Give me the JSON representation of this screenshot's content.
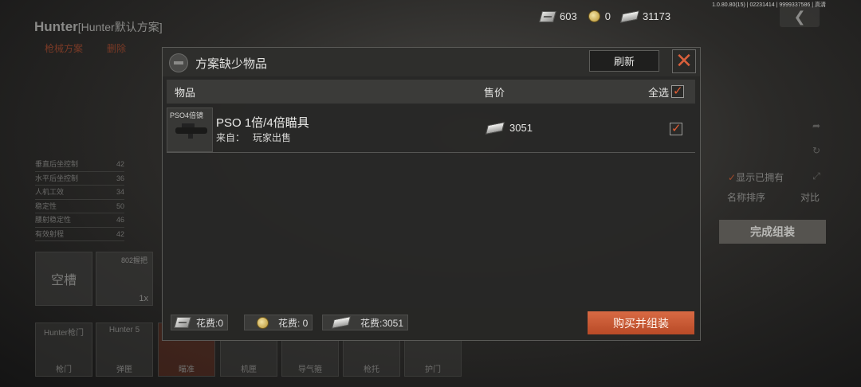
{
  "version_text": "1.0.80.80(15) | 02231414 | 9999337586 | 高清",
  "currency": [
    {
      "icon": "voucher-icon",
      "value": "603"
    },
    {
      "icon": "coin-icon",
      "value": "0"
    },
    {
      "icon": "cash-icon",
      "value": "31173"
    }
  ],
  "background": {
    "title": "Hunter",
    "title_sub": "[Hunter默认方案]",
    "tabs": [
      "枪械方案",
      "删除"
    ],
    "stats": [
      {
        "label": "垂直后坐控制",
        "value": "42"
      },
      {
        "label": "水平后坐控制",
        "value": "36"
      },
      {
        "label": "人机工效",
        "value": "34"
      },
      {
        "label": "稳定性",
        "value": "50"
      },
      {
        "label": "腰射稳定性",
        "value": "46"
      },
      {
        "label": "有效射程",
        "value": "42"
      }
    ],
    "empty_slot": "空槽",
    "slot_802": {
      "label": "802握把",
      "qty": "1x"
    },
    "bottom_slots": [
      {
        "top": "Hunter枪门",
        "bottom": "枪门"
      },
      {
        "top": "Hunter 5",
        "bottom": "弹匣"
      },
      {
        "top": "",
        "bottom": "瞄准"
      },
      {
        "top": "",
        "bottom": "机匣"
      },
      {
        "top": "",
        "bottom": "导气箍"
      },
      {
        "top": "",
        "bottom": "枪托"
      },
      {
        "top": "",
        "bottom": "护门"
      }
    ],
    "show_owned": "显示已拥有",
    "sort_name": "名称排序",
    "compare": "对比",
    "complete_button": "完成组装"
  },
  "modal": {
    "title": "方案缺少物品",
    "refresh_button": "刷新",
    "close_icon": "close-icon",
    "columns": {
      "item": "物品",
      "price": "售价",
      "select_all": "全选"
    },
    "items": [
      {
        "thumb_label": "PSO4倍镜",
        "name": "PSO 1倍/4倍瞄具",
        "source_label": "来自：",
        "source": "玩家出售",
        "price": "3051",
        "checked": true
      }
    ],
    "footer": {
      "costs": [
        {
          "icon": "voucher-icon",
          "text": "花费:0"
        },
        {
          "icon": "coin-icon",
          "text": "花费: 0"
        },
        {
          "icon": "cash-icon",
          "text": "花费:3051"
        }
      ],
      "buy_button": "购买并组装"
    }
  }
}
